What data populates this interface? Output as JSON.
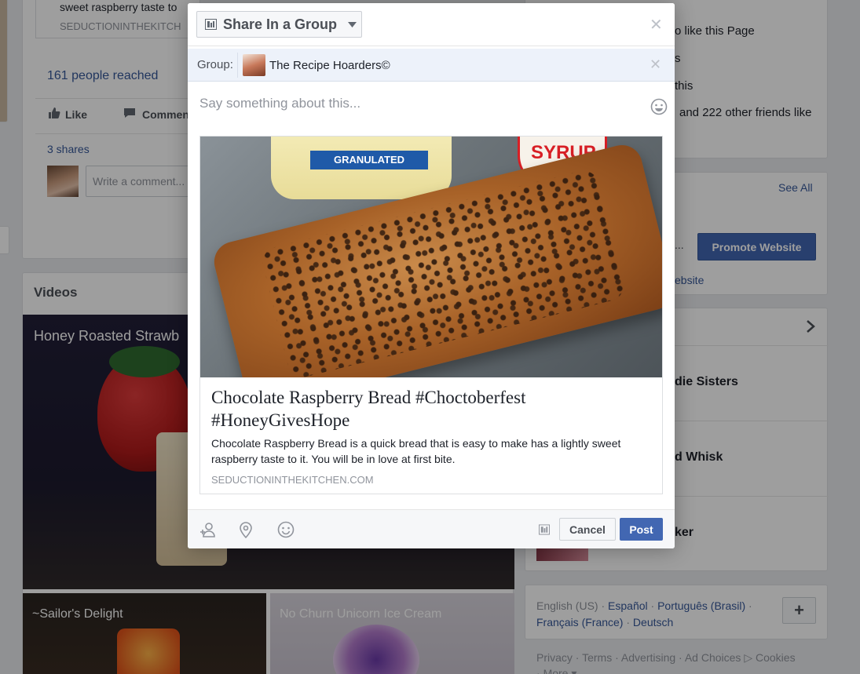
{
  "background": {
    "post_partial": {
      "desc_fragment": "sweet raspberry taste to",
      "desc_fragment_2": "You will be in love at first bite",
      "source": "SEDUCTIONINTHEKITCH",
      "reach": "161 people reached",
      "like_label": "Like",
      "comment_label": "Comment",
      "shares": "3 shares",
      "comment_placeholder": "Write a comment..."
    },
    "videos": {
      "heading": "Videos",
      "main_title": "Honey Roasted Strawb",
      "thumb1_title": "~Sailor's Delight",
      "thumb2_title": "No Churn Unicorn Ice Cream"
    },
    "right_col": {
      "top_lines": [
        "o like this Page",
        "s",
        "this",
        "and 222 other friends like"
      ],
      "see_all": "See All",
      "ellipsis": "...",
      "promote_button": "Promote Website",
      "website_link": "ebsite",
      "row_names": [
        "die Sisters",
        "d Whisk",
        "ker"
      ],
      "languages": {
        "current": "English (US)",
        "options": [
          "Español",
          "Português (Brasil)",
          "Français (France)",
          "Deutsch"
        ],
        "add_label": "+"
      },
      "footer_links": [
        "Privacy",
        "Terms",
        "Advertising",
        "Ad Choices",
        "Cookies",
        "More"
      ]
    }
  },
  "dialog": {
    "share_button_label": "Share In a Group",
    "group_label": "Group:",
    "group_name": "The Recipe Hoarders©",
    "post_placeholder": "Say something about this...",
    "preview": {
      "title": "Chocolate Raspberry Bread #Choctoberfest #HoneyGivesHope",
      "description": "Chocolate Raspberry Bread is a quick bread that is easy to make has a lightly sweet raspberry taste to it. You will be in love at first bite.",
      "source": "SEDUCTIONINTHEKITCHEN.COM",
      "bag_label": "GRANULATED",
      "bottle_label": "SYRUP"
    },
    "cancel_label": "Cancel",
    "post_label": "Post"
  },
  "colors": {
    "facebook_blue": "#4267b2",
    "link_blue": "#365899",
    "page_bg": "#e9ebee"
  }
}
